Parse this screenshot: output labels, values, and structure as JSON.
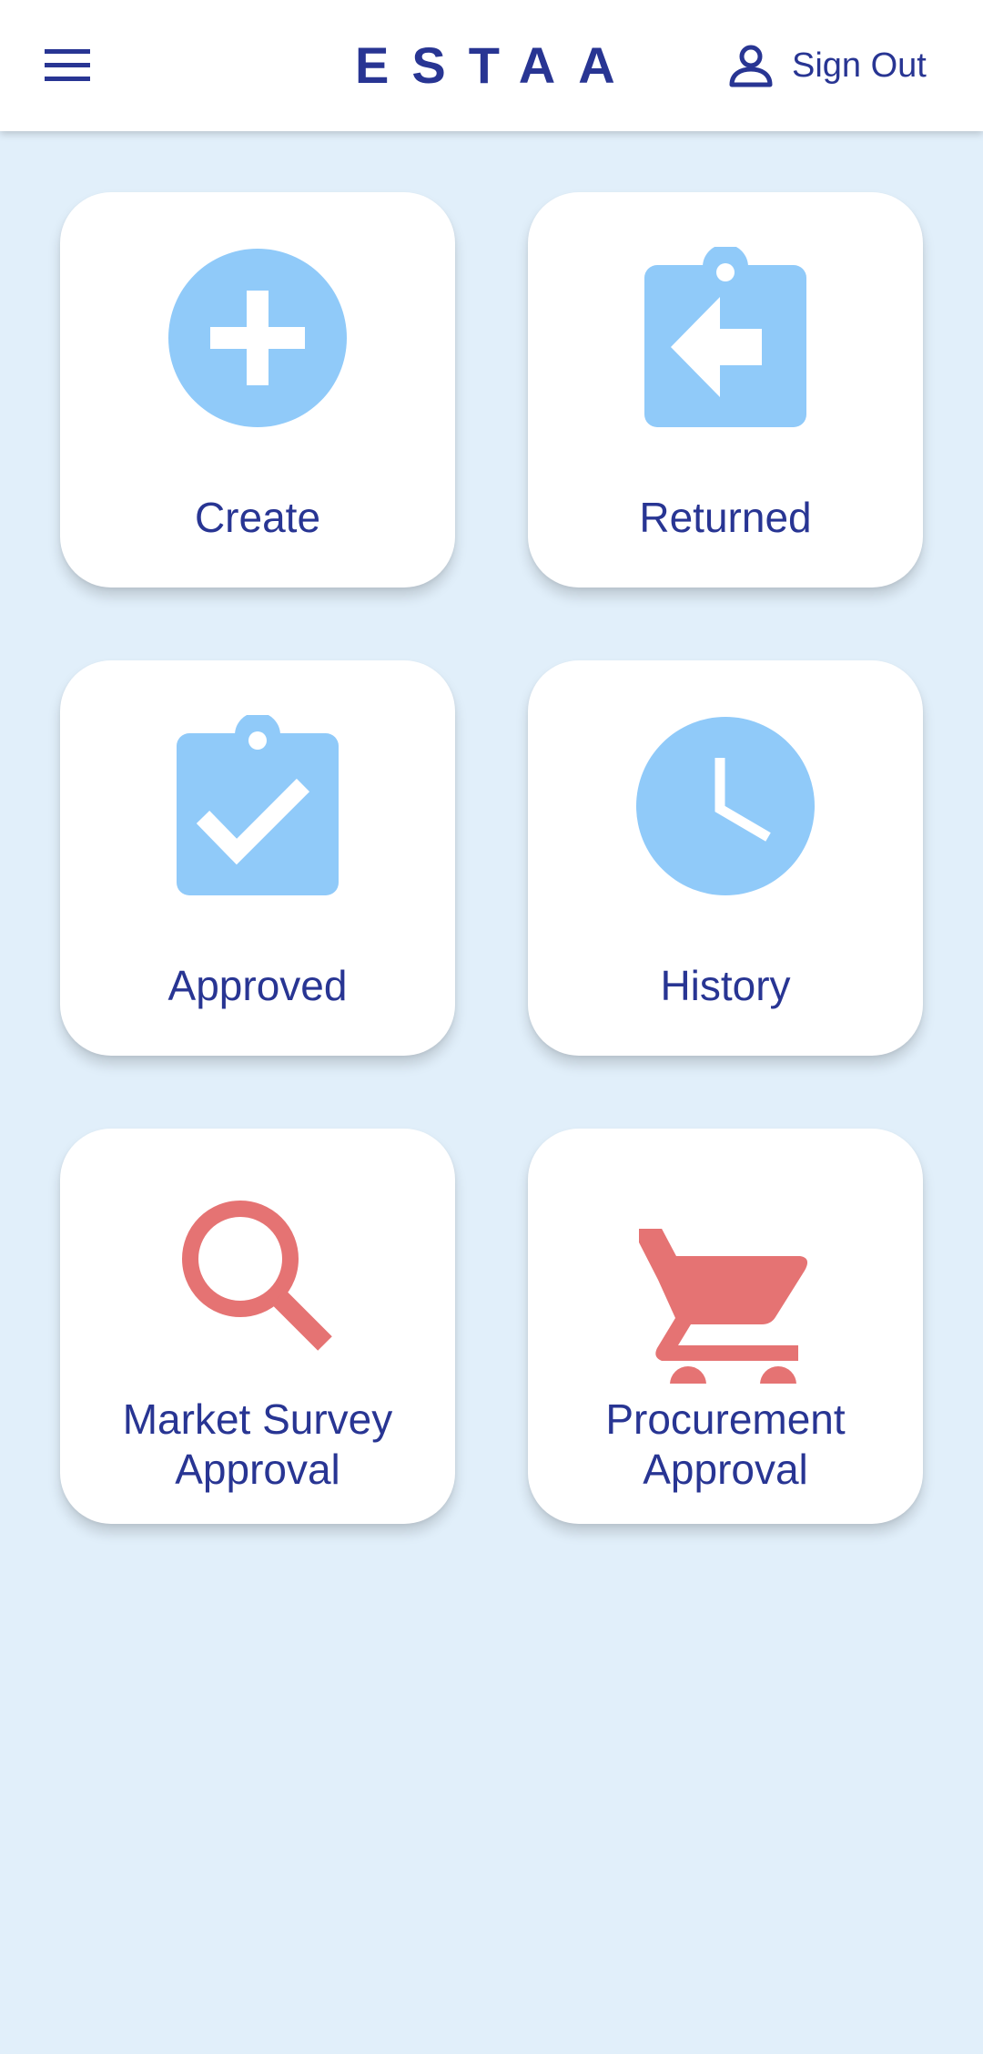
{
  "app_bar": {
    "title": "ESTAA",
    "menu_icon": "hamburger-menu-icon",
    "account_icon": "person-outline-icon",
    "sign_out_label": "Sign Out"
  },
  "tiles": [
    {
      "label": "Create",
      "icon": "add-circle-icon",
      "icon_color": "#90caf9"
    },
    {
      "label": "Returned",
      "icon": "clipboard-return-icon",
      "icon_color": "#90caf9"
    },
    {
      "label": "Approved",
      "icon": "clipboard-check-icon",
      "icon_color": "#90caf9"
    },
    {
      "label": "History",
      "icon": "clock-icon",
      "icon_color": "#90caf9"
    },
    {
      "label_line1": "Market Survey",
      "label_line2": "Approval",
      "icon": "search-icon",
      "icon_color": "#e57373"
    },
    {
      "label_line1": "Procurement",
      "label_line2": "Approval",
      "icon": "shopping-cart-icon",
      "icon_color": "#e57373"
    }
  ],
  "colors": {
    "primary_text": "#283593",
    "background": "#e1effa",
    "blue_icon": "#90caf9",
    "red_icon": "#e57373"
  }
}
